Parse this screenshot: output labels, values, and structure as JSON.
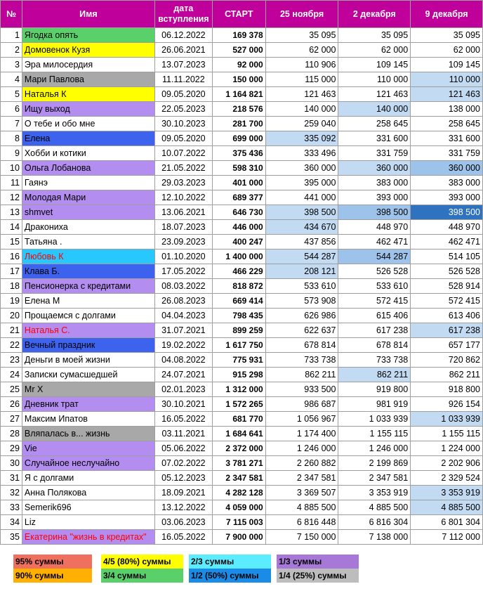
{
  "header": {
    "num": "№",
    "name": "Имя",
    "date_line1": "дата",
    "date_line2": "вступления",
    "start": "СТАРТ",
    "c1": "25 ноября",
    "c2": "2 декабря",
    "c3": "9 декабря"
  },
  "colors": {
    "header_bg": "#c0009a",
    "green": "#5ad06a",
    "yellow": "#ffff00",
    "grey": "#a8a8a8",
    "purple": "#b38df0",
    "blue": "#3d63ee",
    "cyan": "#28c8ff",
    "light_blue": "#c2daf2",
    "mid_blue": "#9dc3ea",
    "dark_blue": "#2e72c0",
    "red_text": "#ff0000"
  },
  "rows": [
    {
      "n": "1",
      "name": "Ягодка опять",
      "date": "06.12.2022",
      "start": "169 378",
      "v1": "35 095",
      "v2": "35 095",
      "v3": "35 095",
      "bg": "green"
    },
    {
      "n": "2",
      "name": "Домовенок Кузя",
      "date": "26.06.2021",
      "start": "527 000",
      "v1": "62 000",
      "v2": "62 000",
      "v3": "62 000",
      "bg": "yellow"
    },
    {
      "n": "3",
      "name": "Эра милосердия",
      "date": "13.07.2023",
      "start": "92 000",
      "v1": "110 906",
      "v2": "109 145",
      "v3": "109 145"
    },
    {
      "n": "4",
      "name": "Мари Павлова",
      "date": "11.11.2022",
      "start": "150 000",
      "v1": "115 000",
      "v2": "110 000",
      "v3": "110 000",
      "bg": "grey",
      "h3": "light_blue"
    },
    {
      "n": "5",
      "name": "Наталья К",
      "date": "09.05.2020",
      "start": "1 164 821",
      "v1": "121 463",
      "v2": "121 463",
      "v3": "121 463",
      "bg": "yellow",
      "h3": "light_blue"
    },
    {
      "n": "6",
      "name": "Ищу выход",
      "date": "22.05.2023",
      "start": "218 576",
      "v1": "140 000",
      "v2": "140 000",
      "v3": "138 000",
      "bg": "purple",
      "h2": "light_blue"
    },
    {
      "n": "7",
      "name": "О тебе и обо мне",
      "date": "30.10.2023",
      "start": "281 700",
      "v1": "259 040",
      "v2": "258 645",
      "v3": "258 645"
    },
    {
      "n": "8",
      "name": "Елена",
      "date": "09.05.2020",
      "start": "699 000",
      "v1": "335 092",
      "v2": "331 600",
      "v3": "331 600",
      "bg": "blue",
      "h1": "light_blue"
    },
    {
      "n": "9",
      "name": "Хобби и котики",
      "date": "10.07.2022",
      "start": "375 436",
      "v1": "333 496",
      "v2": "331 759",
      "v3": "331 759"
    },
    {
      "n": "10",
      "name": "Ольга Лобанова",
      "date": "21.05.2022",
      "start": "598 310",
      "v1": "360 000",
      "v2": "360 000",
      "v3": "360 000",
      "bg": "purple",
      "h2": "light_blue",
      "h3": "mid_blue"
    },
    {
      "n": "11",
      "name": "Гаянэ",
      "date": "29.03.2023",
      "start": "401 000",
      "v1": "395 000",
      "v2": "383 000",
      "v3": "383 000"
    },
    {
      "n": "12",
      "name": "Молодая Мари",
      "date": "12.10.2022",
      "start": "689 377",
      "v1": "441 000",
      "v2": "393 000",
      "v3": "393 000",
      "bg": "purple"
    },
    {
      "n": "13",
      "name": "shmvet",
      "date": "13.06.2021",
      "start": "646 730",
      "v1": "398 500",
      "v2": "398 500",
      "v3": "398 500",
      "bg": "purple",
      "h1": "light_blue",
      "h2": "mid_blue",
      "h3": "dark_blue"
    },
    {
      "n": "14",
      "name": "Дракониха",
      "date": "18.07.2023",
      "start": "446 000",
      "v1": "434 670",
      "v2": "448 970",
      "v3": "448 970",
      "h1": "light_blue"
    },
    {
      "n": "15",
      "name": "Татьяна .",
      "date": "23.09.2023",
      "start": "400 247",
      "v1": "437 856",
      "v2": "462 471",
      "v3": "462 471"
    },
    {
      "n": "16",
      "name": "Любовь К",
      "date": "01.10.2020",
      "start": "1 400 000",
      "v1": "544 287",
      "v2": "544 287",
      "v3": "514 105",
      "bg": "cyan",
      "red": true,
      "h1": "light_blue",
      "h2": "mid_blue"
    },
    {
      "n": "17",
      "name": "Клава Б.",
      "date": "17.05.2022",
      "start": "466 229",
      "v1": "208 121",
      "v2": "526 528",
      "v3": "526 528",
      "bg": "blue",
      "h1": "light_blue"
    },
    {
      "n": "18",
      "name": "Пенсионерка с кредитами",
      "date": "08.03.2022",
      "start": "818 872",
      "v1": "533 610",
      "v2": "533 610",
      "v3": "528 914",
      "bg": "purple"
    },
    {
      "n": "19",
      "name": "Елена М",
      "date": "26.08.2023",
      "start": "669 414",
      "v1": "573 908",
      "v2": "572 415",
      "v3": "572 415"
    },
    {
      "n": "20",
      "name": "Прощаемся с долгами",
      "date": "04.04.2023",
      "start": "798 435",
      "v1": "626 986",
      "v2": "615 406",
      "v3": "613 406"
    },
    {
      "n": "21",
      "name": "Наталья С.",
      "date": "31.07.2021",
      "start": "899 259",
      "v1": "622 637",
      "v2": "617 238",
      "v3": "617 238",
      "bg": "purple",
      "red": true,
      "h3": "light_blue"
    },
    {
      "n": "22",
      "name": "Вечный праздник",
      "date": "19.02.2022",
      "start": "1 617 750",
      "v1": "678 814",
      "v2": "678 814",
      "v3": "657 177",
      "bg": "blue"
    },
    {
      "n": "23",
      "name": "Деньги в моей жизни",
      "date": "04.08.2022",
      "start": "775 931",
      "v1": "733 738",
      "v2": "733 738",
      "v3": "720 862"
    },
    {
      "n": "24",
      "name": "Записки сумасшедшей",
      "date": "24.07.2021",
      "start": "915 298",
      "v1": "862 211",
      "v2": "862 211",
      "v3": "862 211",
      "h2": "light_blue"
    },
    {
      "n": "25",
      "name": "Mr X",
      "date": "02.01.2023",
      "start": "1 312 000",
      "v1": "933 500",
      "v2": "919 800",
      "v3": "918 800",
      "bg": "grey"
    },
    {
      "n": "26",
      "name": "Дневник трат",
      "date": "30.10.2021",
      "start": "1 572 265",
      "v1": "986 687",
      "v2": "981 919",
      "v3": "926 154",
      "bg": "purple"
    },
    {
      "n": "27",
      "name": "Максим Ипатов",
      "date": "16.05.2022",
      "start": "681 770",
      "v1": "1 056 967",
      "v2": "1 033 939",
      "v3": "1 033 939",
      "h3": "light_blue"
    },
    {
      "n": "28",
      "name": "Вляпалась в... жизнь",
      "date": "03.11.2021",
      "start": "1 684 641",
      "v1": "1 174 400",
      "v2": "1 155 115",
      "v3": "1 155 115",
      "bg": "grey"
    },
    {
      "n": "29",
      "name": "Vie",
      "date": "05.06.2022",
      "start": "2 372 000",
      "v1": "1 246 000",
      "v2": "1 246 000",
      "v3": "1 224 000",
      "bg": "purple"
    },
    {
      "n": "30",
      "name": "Случайное неслучайно",
      "date": "07.02.2022",
      "start": "3 781 271",
      "v1": "2 260 882",
      "v2": "2 199 869",
      "v3": "2 202 906",
      "bg": "purple"
    },
    {
      "n": "31",
      "name": "Я с долгами",
      "date": "05.12.2023",
      "start": "2 347 581",
      "v1": "2 347 581",
      "v2": "2 347 581",
      "v3": "2 329 524"
    },
    {
      "n": "32",
      "name": "Анна Полякова",
      "date": "18.09.2021",
      "start": "4 282 128",
      "v1": "3 369 507",
      "v2": "3 353 919",
      "v3": "3 353 919",
      "h3": "light_blue"
    },
    {
      "n": "33",
      "name": "Semerik696",
      "date": "13.12.2022",
      "start": "4 059 000",
      "v1": "4 885 500",
      "v2": "4 885 500",
      "v3": "4 885 500",
      "h3": "light_blue"
    },
    {
      "n": "34",
      "name": "Liz",
      "date": "03.06.2023",
      "start": "7 115 003",
      "v1": "6 816 448",
      "v2": "6 816 304",
      "v3": "6 801 304"
    },
    {
      "n": "35",
      "name": "Екатерина \"жизнь в кредитах\"",
      "date": "16.05.2022",
      "start": "7 900 000",
      "v1": "7 150 000",
      "v2": "7 138 000",
      "v3": "7 112 000",
      "bg": "purple",
      "red": true
    }
  ],
  "legend": [
    {
      "label": "95% суммы",
      "color": "#f07060"
    },
    {
      "label": "90% суммы",
      "color": "#ffb000"
    },
    {
      "label": "4/5 (80%) суммы",
      "color": "#ffff00"
    },
    {
      "label": "3/4 суммы",
      "color": "#5ad06a"
    },
    {
      "label": "2/3 суммы",
      "color": "#5cecff"
    },
    {
      "label": "1/2 (50%) суммы",
      "color": "#1a8ce8"
    },
    {
      "label": "1/3 суммы",
      "color": "#a878d8"
    },
    {
      "label": "1/4 (25%) суммы",
      "color": "#bdbdbd"
    }
  ]
}
